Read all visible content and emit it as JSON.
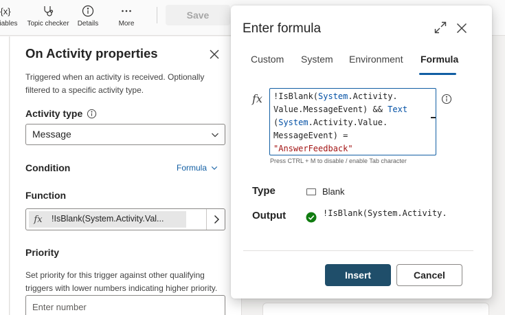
{
  "toolbar": {
    "variables_label": "ariables",
    "variables_icon_text": "{x}",
    "topic_checker_label": "Topic checker",
    "details_label": "Details",
    "more_label": "More",
    "save_label": "Save"
  },
  "properties": {
    "title": "On Activity properties",
    "description": "Triggered when an activity is received. Optionally filtered to a specific activity type.",
    "activity_type_label": "Activity type",
    "activity_type_value": "Message",
    "condition_label": "Condition",
    "condition_mode": "Formula",
    "function_label": "Function",
    "function_fx": "fx",
    "function_value": "!IsBlank(System.Activity.Val...",
    "priority_label": "Priority",
    "priority_description": "Set priority for this trigger against other qualifying triggers with lower numbers indicating higher priority.",
    "priority_placeholder": "Enter number"
  },
  "dialog": {
    "title": "Enter formula",
    "tabs": [
      {
        "label": "Custom",
        "selected": false
      },
      {
        "label": "System",
        "selected": false
      },
      {
        "label": "Environment",
        "selected": false
      },
      {
        "label": "Formula",
        "selected": true
      }
    ],
    "fx_label": "fx",
    "formula_tokens": {
      "t1": "!IsBlank(",
      "t2": "System",
      "t3": ".Activity.",
      "t4": "Value.MessageEvent) && ",
      "t5": "Text",
      "t6": "(",
      "t7": "System",
      "t8": ".Activity.Value.",
      "t9": "MessageEvent) =",
      "t10": "\"AnswerFeedback\""
    },
    "hint": "Press CTRL + M to disable / enable Tab character",
    "type_label": "Type",
    "type_value": "Blank",
    "output_label": "Output",
    "output_value": "!IsBlank(System.Activity.",
    "insert_label": "Insert",
    "cancel_label": "Cancel"
  },
  "colors": {
    "accent": "#115ea3",
    "primary_button": "#1f4e6a",
    "success": "#107c10",
    "code_function": "#0451a5",
    "code_string": "#a31515"
  }
}
